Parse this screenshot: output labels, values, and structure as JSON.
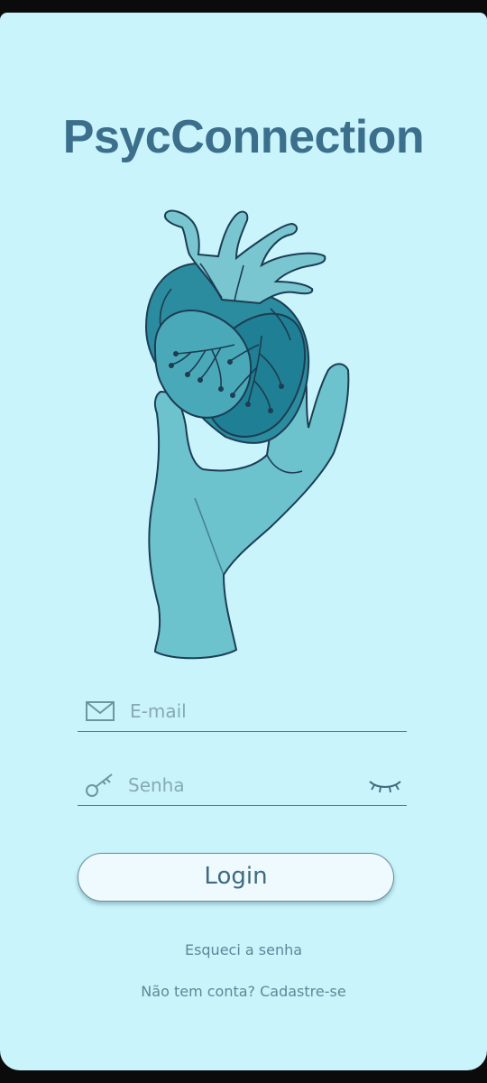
{
  "app": {
    "title": "PsycConnection"
  },
  "illustration": {
    "name": "hand-holding-heart-illustration",
    "colors": {
      "hand": "#6cc2cd",
      "heart_dark": "#2b8b9f",
      "heart_mid": "#4aa9b9",
      "heart_light": "#79c6d1",
      "outline": "#1c3d52"
    }
  },
  "login_form": {
    "email_placeholder": "E-mail",
    "email_icon": "envelope-icon",
    "password_placeholder": "Senha",
    "password_icon": "key-icon",
    "toggle_visibility_icon": "eye-closed-icon",
    "login_label": "Login",
    "forgot_password": "Esqueci a senha",
    "signup_prompt": "Não tem conta? Cadastre-se"
  },
  "colors": {
    "background": "#c9f4fb",
    "title": "#3b6f8c",
    "button_bg": "#eefafd",
    "link": "#5d8798"
  }
}
